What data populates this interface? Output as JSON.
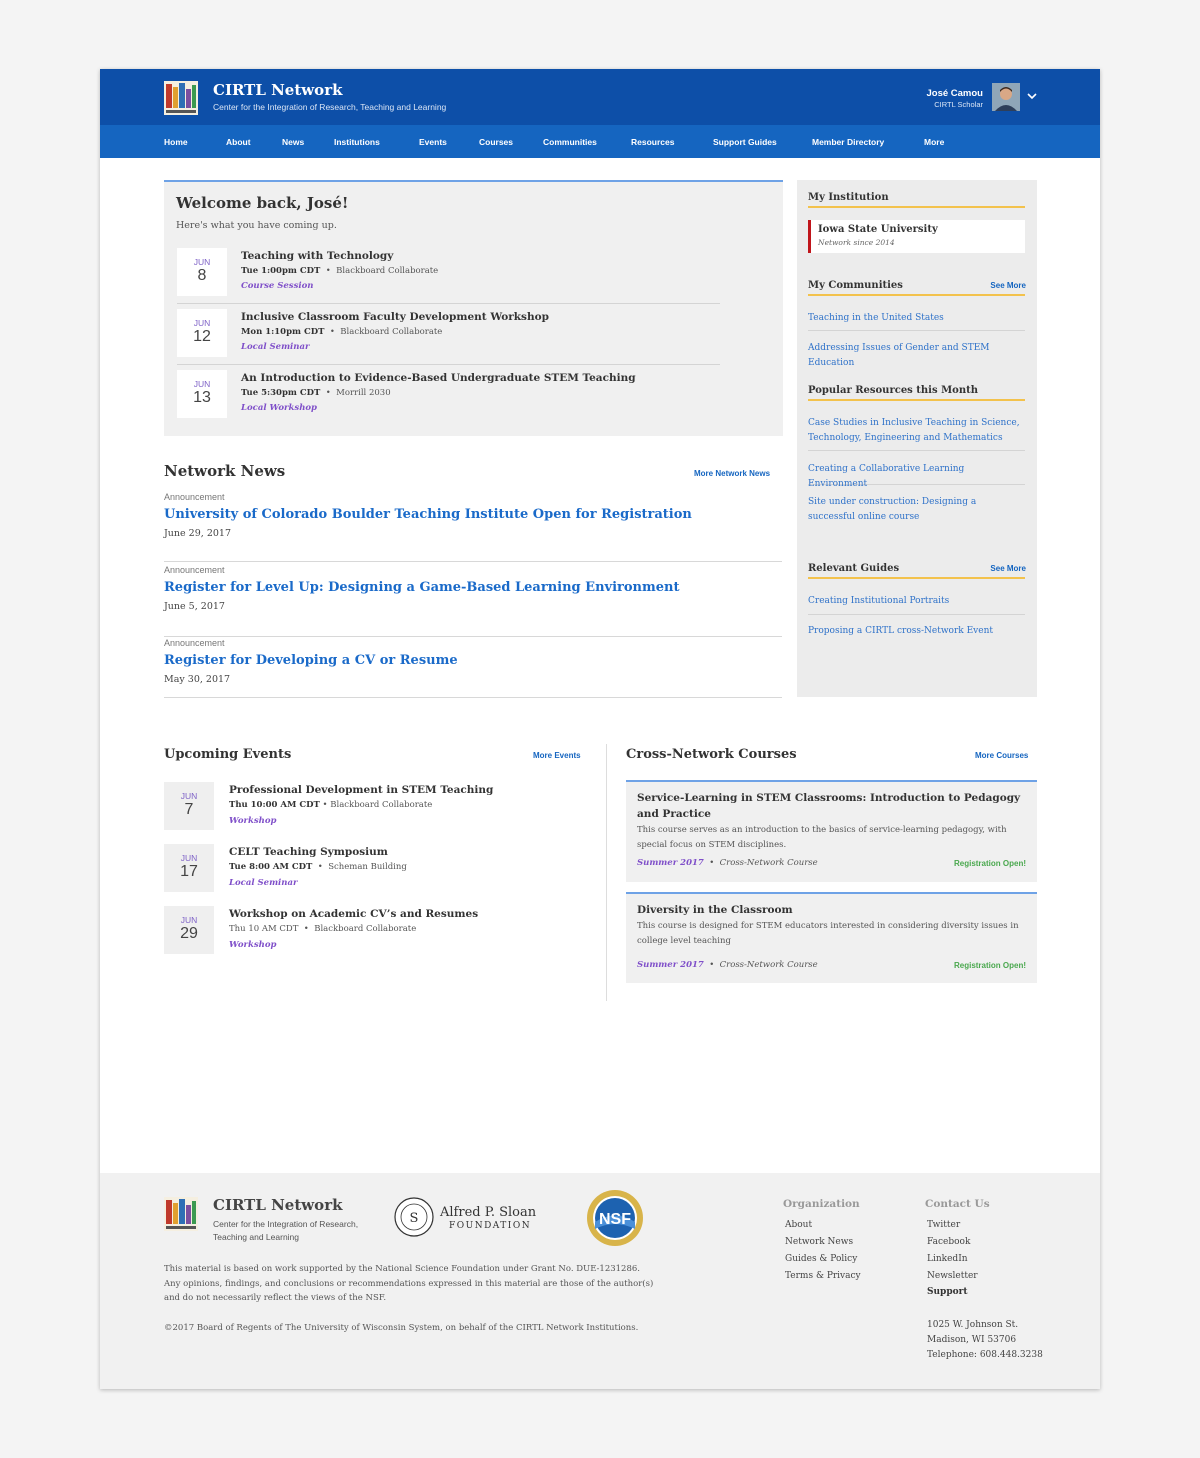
{
  "header": {
    "site_title": "CIRTL Network",
    "site_subtitle": "Center for the Integration of Research, Teaching and Learning",
    "user_name": "José Camou",
    "user_role": "CIRTL Scholar"
  },
  "nav": [
    "Home",
    "About",
    "News",
    "Institutions",
    "Events",
    "Courses",
    "Communities",
    "Resources",
    "Support Guides",
    "Member Directory",
    "More"
  ],
  "welcome": {
    "title": "Welcome back, José!",
    "subtitle": "Here's what you have coming up.",
    "events": [
      {
        "month": "JUN",
        "day": "8",
        "title": "Teaching with Technology",
        "time": "Tue 1:00pm CDT",
        "location": "Blackboard Collaborate",
        "type": "Course Session"
      },
      {
        "month": "JUN",
        "day": "12",
        "title": "Inclusive Classroom Faculty Development Workshop",
        "time": "Mon 1:10pm CDT",
        "location": "Blackboard Collaborate",
        "type": "Local Seminar"
      },
      {
        "month": "JUN",
        "day": "13",
        "title": "An Introduction to Evidence-Based Undergraduate STEM Teaching",
        "time": "Tue 5:30pm CDT",
        "location": "Morrill 2030",
        "type": "Local Workshop"
      }
    ]
  },
  "sidebar": {
    "my_institution": {
      "title": "My Institution",
      "name": "Iowa State University",
      "since": "Network since 2014"
    },
    "communities": {
      "title": "My Communities",
      "see_more": "See More",
      "items": [
        "Teaching in the United States",
        "Addressing Issues of Gender and STEM Education"
      ]
    },
    "resources": {
      "title": "Popular Resources this Month",
      "items": [
        "Case Studies in Inclusive Teaching in Science, Technology, Engineering and Mathematics",
        "Creating a Collaborative Learning Environment",
        "Site under construction: Designing a successful online course"
      ]
    },
    "guides": {
      "title": "Relevant Guides",
      "see_more": "See More",
      "items": [
        "Creating Institutional Portraits",
        "Proposing a CIRTL cross-Network Event"
      ]
    }
  },
  "news": {
    "title": "Network News",
    "more": "More Network News",
    "items": [
      {
        "kind": "Announcement",
        "title": "University of Colorado Boulder Teaching Institute Open for Registration",
        "date": "June 29, 2017"
      },
      {
        "kind": "Announcement",
        "title": "Register for Level Up: Designing a Game-Based Learning Environment",
        "date": "June 5, 2017"
      },
      {
        "kind": "Announcement",
        "title": "Register for Developing a CV or Resume",
        "date": "May 30, 2017"
      }
    ]
  },
  "upcoming": {
    "title": "Upcoming Events",
    "more": "More Events",
    "events": [
      {
        "month": "JUN",
        "day": "7",
        "title": "Professional Development in STEM Teaching",
        "time": "Thu 10:00 AM CDT",
        "location": "Blackboard Collaborate",
        "type": "Workshop"
      },
      {
        "month": "JUN",
        "day": "17",
        "title": "CELT Teaching Symposium",
        "time": "Tue 8:00 AM CDT",
        "location": "Scheman Building",
        "type": "Local Seminar"
      },
      {
        "month": "JUN",
        "day": "29",
        "title": "Workshop on Academic CV’s and Resumes",
        "time": "Thu 10 AM CDT",
        "location": "Blackboard Collaborate",
        "type": "Workshop"
      }
    ]
  },
  "courses": {
    "title": "Cross-Network Courses",
    "more": "More Courses",
    "items": [
      {
        "title": "Service-Learning in STEM Classrooms: Introduction to Pedagogy and Practice",
        "description": "This course serves as an introduction to the basics of service-learning pedagogy, with special focus on STEM disciplines.",
        "term": "Summer 2017",
        "kind": "Cross-Network Course",
        "status": "Registration Open!"
      },
      {
        "title": "Diversity in the Classroom",
        "description": "This course is designed for STEM educators interested in considering diversity issues in college level teaching",
        "term": "Summer 2017",
        "kind": "Cross-Network Course",
        "status": "Registration Open!"
      }
    ]
  },
  "footer": {
    "title": "CIRTL Network",
    "subtitle": "Center for the Integration of Research, Teaching and Learning",
    "sloan_line1": "Alfred P. Sloan",
    "sloan_line2": "FOUNDATION",
    "nsf_label": "NSF",
    "legal": "This material is based on work supported by the National Science Foundation under Grant No. DUE-1231286. Any opinions, findings, and conclusions or recommendations expressed in this material are those of the author(s) and do not necessarily reflect the views of the NSF.",
    "copyright": "©2017 Board of Regents of The University of Wisconsin System, on behalf of the CIRTL Network Institutions.",
    "organization": {
      "title": "Organization",
      "links": [
        "About",
        "Network News",
        "Guides & Policy",
        "Terms & Privacy"
      ]
    },
    "contact": {
      "title": "Contact Us",
      "links": [
        "Twitter",
        "Facebook",
        "LinkedIn",
        "Newsletter",
        "Support"
      ]
    },
    "address": [
      "1025 W. Johnson St.",
      "Madison, WI 53706",
      "Telephone: 608.448.3238"
    ]
  },
  "colors": {
    "header_blue": "#0d4fa8",
    "nav_blue": "#1565c0",
    "link_blue": "#1a6ac9",
    "accent_purple": "#7f4fc9",
    "accent_gold": "#f3c24c",
    "institution_red": "#c0151b",
    "status_green": "#4aa84e"
  }
}
